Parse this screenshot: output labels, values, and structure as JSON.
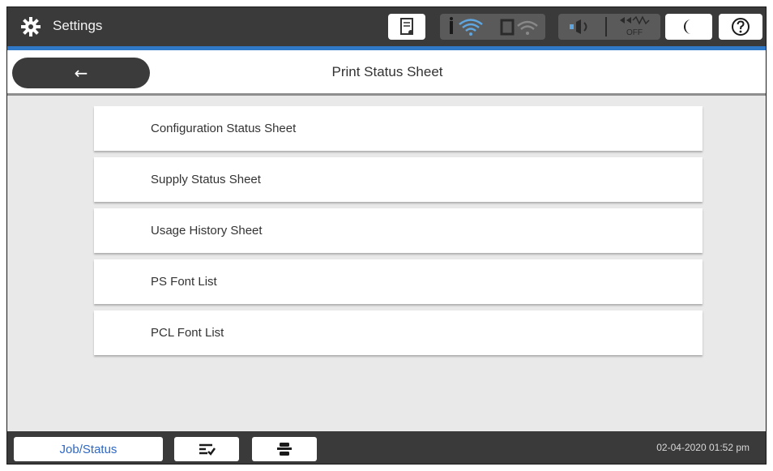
{
  "topbar": {
    "title": "Settings",
    "icons": [
      "gear-icon",
      "paper-status-icon",
      "wifi-icon",
      "wifi-direct-icon",
      "speaker-icon",
      "power-off-icon",
      "moon-icon",
      "help-icon"
    ],
    "power_label": "OFF"
  },
  "header": {
    "back_symbol": "←",
    "title": "Print Status Sheet"
  },
  "menu": {
    "items": [
      {
        "label": "Configuration Status Sheet"
      },
      {
        "label": "Supply Status Sheet"
      },
      {
        "label": "Usage History Sheet"
      },
      {
        "label": "PS Font List"
      },
      {
        "label": "PCL Font List"
      }
    ]
  },
  "bottombar": {
    "job_status_label": "Job/Status",
    "datetime": "02-04-2020 01:52 pm"
  },
  "colors": {
    "bar": "#3a3a3a",
    "accent_blue": "#2f79c8",
    "job_text": "#2f68c4",
    "background": "#e9e9e9"
  }
}
